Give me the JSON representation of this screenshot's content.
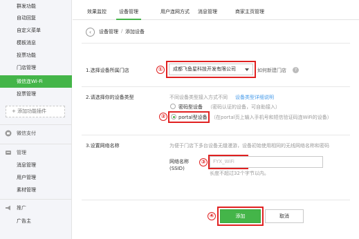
{
  "sidebar": {
    "items": [
      {
        "label": "群发功能"
      },
      {
        "label": "自动回复"
      },
      {
        "label": "自定义菜单"
      },
      {
        "label": "模板消息"
      },
      {
        "label": "投票功能"
      },
      {
        "label": "门店管理"
      },
      {
        "label": "微信连Wi-Fi"
      },
      {
        "label": "投票管理"
      }
    ],
    "add_plugin": "+ 添加功能插件",
    "groups": [
      {
        "title": "微信支付",
        "icon": "wallet-icon"
      },
      {
        "title": "管理",
        "icon": "manage-icon",
        "items": [
          {
            "label": "消息管理"
          },
          {
            "label": "用户管理"
          },
          {
            "label": "素材管理"
          }
        ]
      },
      {
        "title": "推广",
        "icon": "megaphone-icon",
        "items": [
          {
            "label": "广告主"
          }
        ]
      }
    ]
  },
  "tabs": [
    {
      "label": "效果监控"
    },
    {
      "label": "设备管理"
    },
    {
      "label": "用户连网方式"
    },
    {
      "label": "消息管理"
    },
    {
      "label": "商家主页管理"
    }
  ],
  "breadcrumb": {
    "back_icon": "back-arrow-icon",
    "parent": "设备管理",
    "separator": "/",
    "current": "添加设备"
  },
  "form": {
    "step1": {
      "label": "1.选择设备所属门店",
      "selected_store": "成都飞鱼星科技开发有限公司",
      "new_store_link": "如何新建门店"
    },
    "step2": {
      "label": "2.请选择你的设备类型",
      "hint_prefix": "不同设备类型接入方式不同",
      "hint_link": "设备类型详细说明",
      "options": [
        {
          "label": "密码型设备",
          "desc": "（密码认证的设备，可自助接入）",
          "checked": false
        },
        {
          "label": "portal型设备",
          "desc": "（在portal页上输入手机号和短信验证码连WiFi的设备）",
          "checked": true
        }
      ]
    },
    "step3": {
      "label": "3.设置网络名称",
      "hint": "为便于门店下多台设备无缝漫游，设备初始使用相同的无线网络名称和密码",
      "field_label": "网络名称",
      "field_sublabel": "(SSID)",
      "ssid_value": "FYX_WiFi",
      "length_hint": "长度不超过32个字节以内。"
    },
    "buttons": {
      "submit": "添加",
      "cancel": "取消"
    }
  },
  "annotations": [
    "①",
    "②",
    "③",
    "④"
  ],
  "colors": {
    "accent_green": "#44b549",
    "annotation_red": "#e02020",
    "link_blue": "#459ae9"
  }
}
